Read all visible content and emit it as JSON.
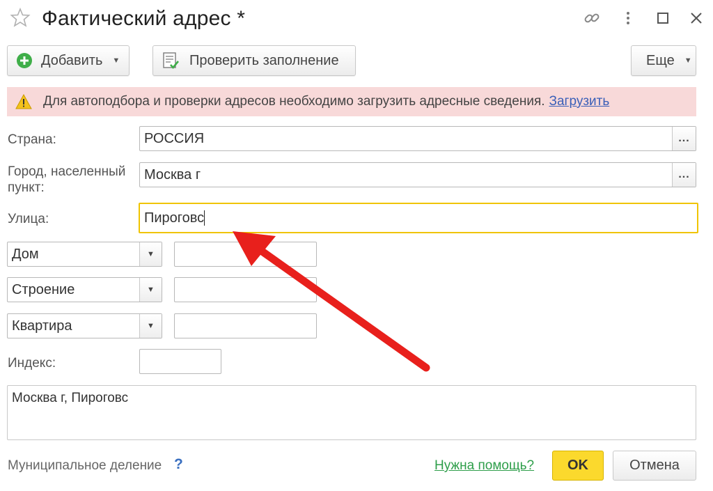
{
  "window": {
    "title": "Фактический адрес *",
    "icons": [
      "star-icon",
      "link-icon",
      "more-vertical-icon",
      "maximize-icon",
      "close-icon"
    ]
  },
  "toolbar": {
    "add_label": "Добавить",
    "check_label": "Проверить заполнение",
    "more_label": "Еще"
  },
  "warning": {
    "text": "Для автоподбора и проверки адресов необходимо загрузить адресные сведения.",
    "link": "Загрузить"
  },
  "form": {
    "country_label": "Страна:",
    "country_value": "РОССИЯ",
    "city_label_line1": "Город, населенный",
    "city_label_line2": "пункт:",
    "city_value": "Москва г",
    "street_label": "Улица:",
    "street_value": "Пироговс",
    "house_type": "Дом",
    "house_value": "",
    "building_type": "Строение",
    "building_value": "",
    "apartment_type": "Квартира",
    "apartment_value": "",
    "index_label": "Индекс:",
    "index_value": "",
    "dots": "...",
    "full_address": "Москва г, Пироговс"
  },
  "footer": {
    "municipal_label": "Муниципальное деление",
    "help_mark": "?",
    "help_link": "Нужна помощь?",
    "ok_label": "OK",
    "cancel_label": "Отмена"
  },
  "colors": {
    "warning_bg": "#f8d9d9",
    "focus_border": "#f0c400",
    "ok_bg": "#fbd92d",
    "link_blue": "#3a5fb8",
    "help_green": "#2e9e4a",
    "arrow_red": "#e8201c"
  }
}
